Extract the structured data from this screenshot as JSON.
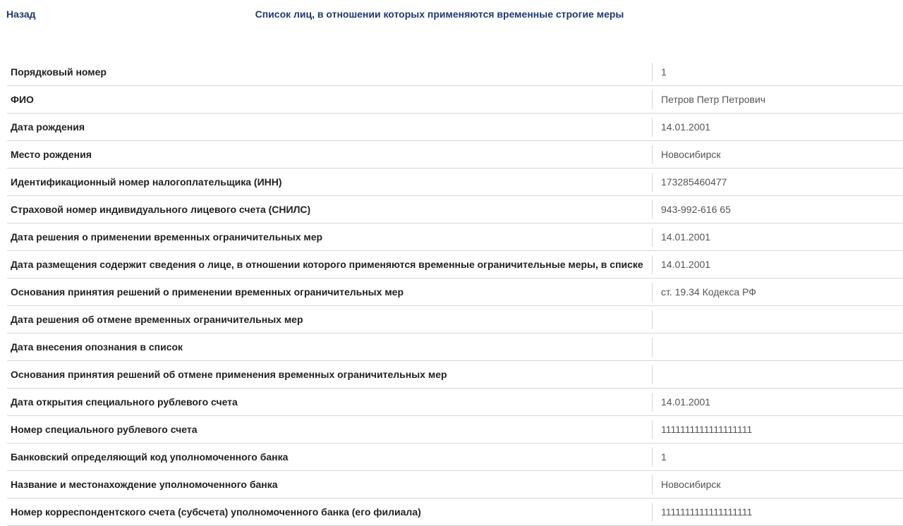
{
  "header": {
    "back_label": "Назад",
    "title": "Список лиц, в отношении которых применяются временные строгие меры"
  },
  "rows": [
    {
      "label": "Порядковый номер",
      "value": "1"
    },
    {
      "label": "ФИО",
      "value": "Петров Петр Петрович"
    },
    {
      "label": "Дата рождения",
      "value": "14.01.2001"
    },
    {
      "label": "Место рождения",
      "value": "Новосибирск"
    },
    {
      "label": "Идентификационный номер налогоплательщика (ИНН)",
      "value": "173285460477"
    },
    {
      "label": "Страховой номер индивидуального лицевого счета (СНИЛС)",
      "value": "943-992-616 65"
    },
    {
      "label": "Дата решения о применении временных ограничительных мер",
      "value": "14.01.2001"
    },
    {
      "label": "Дата размещения содержит сведения о лице, в отношении которого применяются временные ограничительные меры, в списке",
      "value": "14.01.2001"
    },
    {
      "label": "Основания принятия решений о применении временных ограничительных мер",
      "value": "ст. 19.34 Кодекса РФ"
    },
    {
      "label": "Дата решения об отмене временных ограничительных мер",
      "value": ""
    },
    {
      "label": "Дата внесения опознания в список",
      "value": ""
    },
    {
      "label": "Основания принятия решений об отмене применения временных ограничительных мер",
      "value": ""
    },
    {
      "label": "Дата открытия специального рублевого счета",
      "value": "14.01.2001"
    },
    {
      "label": "Номер специального рублевого счета",
      "value": "1111111111111111111"
    },
    {
      "label": "Банковский определяющий код уполномоченного банка",
      "value": "1"
    },
    {
      "label": "Название и местонахождение уполномоченного банка",
      "value": "Новосибирск"
    },
    {
      "label": "Номер корреспондентского счета (субсчета) уполномоченного банка (его филиала)",
      "value": "1111111111111111111"
    }
  ]
}
